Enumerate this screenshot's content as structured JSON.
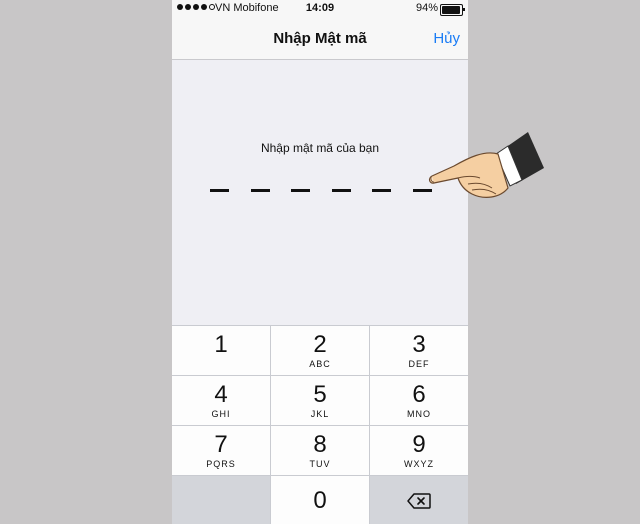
{
  "status_bar": {
    "carrier": "VN Mobifone",
    "time": "14:09",
    "battery_percent": "94%",
    "battery_level": 0.94,
    "signal_bars": 4,
    "signal_max": 5
  },
  "nav": {
    "title": "Nhập Mật mã",
    "cancel_label": "Hủy"
  },
  "passcode": {
    "prompt": "Nhập mật mã của bạn",
    "length": 6,
    "entered": 0
  },
  "keypad": {
    "keys": [
      {
        "digit": "1",
        "letters": ""
      },
      {
        "digit": "2",
        "letters": "ABC"
      },
      {
        "digit": "3",
        "letters": "DEF"
      },
      {
        "digit": "4",
        "letters": "GHI"
      },
      {
        "digit": "5",
        "letters": "JKL"
      },
      {
        "digit": "6",
        "letters": "MNO"
      },
      {
        "digit": "7",
        "letters": "PQRS"
      },
      {
        "digit": "8",
        "letters": "TUV"
      },
      {
        "digit": "9",
        "letters": "WXYZ"
      },
      {
        "digit": "0",
        "letters": ""
      }
    ],
    "delete_icon": "delete-backspace-icon"
  },
  "overlay": {
    "pointer_icon": "pointing-hand-icon"
  },
  "colors": {
    "accent": "#1a7cf5",
    "background": "#efeff4",
    "keypad_bg": "#c9cbd1"
  }
}
